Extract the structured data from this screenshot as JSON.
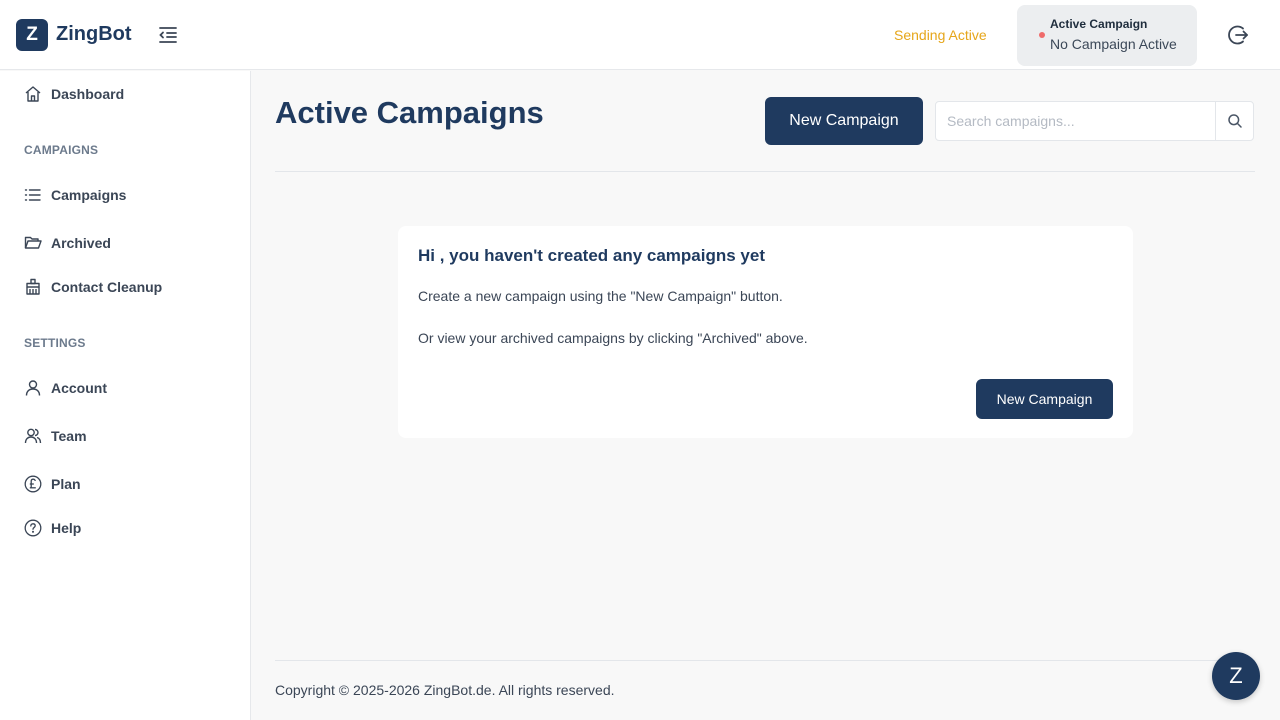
{
  "header": {
    "logo_letter": "Z",
    "brand": "ZingBot",
    "sending_status": "Sending Active",
    "campaign_label": "Active Campaign",
    "campaign_value": "No Campaign Active",
    "icons": {
      "collapse": "menu-collapse-icon",
      "logout": "logout-icon"
    }
  },
  "sidebar": {
    "dashboard": "Dashboard",
    "campaigns_section": "CAMPAIGNS",
    "campaigns_items": [
      {
        "label": "Campaigns",
        "icon": "list-icon"
      },
      {
        "label": "Archived",
        "icon": "folder-open-icon"
      },
      {
        "label": "Contact Cleanup",
        "icon": "cleanup-icon"
      }
    ],
    "settings_section": "SETTINGS",
    "settings_items": [
      {
        "label": "Account",
        "icon": "user-icon"
      },
      {
        "label": "Team",
        "icon": "team-icon"
      },
      {
        "label": "Plan",
        "icon": "pound-icon"
      },
      {
        "label": "Help",
        "icon": "help-icon"
      }
    ]
  },
  "main": {
    "title": "Active Campaigns",
    "new_campaign_label": "New Campaign",
    "search_placeholder": "Search campaigns...",
    "search_value": ""
  },
  "empty_state": {
    "heading": "Hi , you haven't created any campaigns yet",
    "line1": "Create a new campaign using the \"New Campaign\" button.",
    "line2": "Or view your archived campaigns by clicking \"Archived\" above.",
    "button_label": "New Campaign"
  },
  "footer": {
    "copyright": "Copyright © 2025-2026 ZingBot.de. All rights reserved."
  },
  "chat": {
    "letter": "Z"
  },
  "colors": {
    "primary": "#1f3a5f",
    "sending": "#e6a61a",
    "status_dot": "#ef6b6b"
  }
}
